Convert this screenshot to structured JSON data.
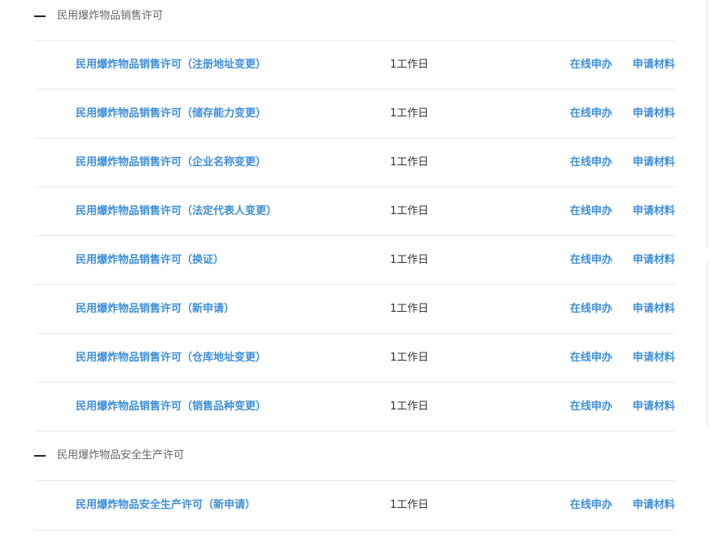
{
  "groups": [
    {
      "title": "民用爆炸物品销售许可",
      "items": [
        {
          "name": "民用爆炸物品销售许可（注册地址变更）",
          "time": "1工作日",
          "online": "在线申办",
          "materials": "申请材料"
        },
        {
          "name": "民用爆炸物品销售许可（储存能力变更）",
          "time": "1工作日",
          "online": "在线申办",
          "materials": "申请材料"
        },
        {
          "name": "民用爆炸物品销售许可（企业名称变更）",
          "time": "1工作日",
          "online": "在线申办",
          "materials": "申请材料"
        },
        {
          "name": "民用爆炸物品销售许可（法定代表人变更）",
          "time": "1工作日",
          "online": "在线申办",
          "materials": "申请材料"
        },
        {
          "name": "民用爆炸物品销售许可（换证）",
          "time": "1工作日",
          "online": "在线申办",
          "materials": "申请材料"
        },
        {
          "name": "民用爆炸物品销售许可（新申请）",
          "time": "1工作日",
          "online": "在线申办",
          "materials": "申请材料"
        },
        {
          "name": "民用爆炸物品销售许可（仓库地址变更）",
          "time": "1工作日",
          "online": "在线申办",
          "materials": "申请材料"
        },
        {
          "name": "民用爆炸物品销售许可（销售品种变更）",
          "time": "1工作日",
          "online": "在线申办",
          "materials": "申请材料"
        }
      ]
    },
    {
      "title": "民用爆炸物品安全生产许可",
      "items": [
        {
          "name": "民用爆炸物品安全生产许可（新申请）",
          "time": "1工作日",
          "online": "在线申办",
          "materials": "申请材料"
        }
      ]
    }
  ],
  "colors": {
    "link": "#3f8fd9",
    "group_title": "#666666",
    "text": "#333333",
    "divider": "#e9e9e9"
  }
}
